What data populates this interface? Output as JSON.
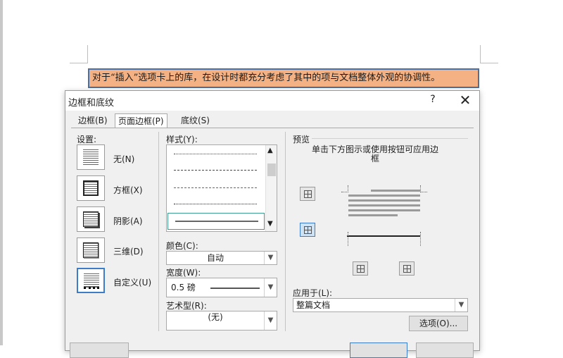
{
  "document": {
    "highlighted_text": "对于“插入”选项卡上的库，在设计时都充分考虑了其中的项与文档整体外观的协调性。"
  },
  "dialog": {
    "title": "边框和底纹",
    "help_label": "?",
    "close_label": "✕",
    "tabs": [
      {
        "label": "边框(B)"
      },
      {
        "label": "页面边框(P)"
      },
      {
        "label": "底纹(S)"
      }
    ],
    "settings": {
      "heading": "设置:",
      "items": [
        {
          "label": "无(N)"
        },
        {
          "label": "方框(X)"
        },
        {
          "label": "阴影(A)"
        },
        {
          "label": "三维(D)"
        },
        {
          "label": "自定义(U)"
        }
      ]
    },
    "style": {
      "heading": "样式(Y):",
      "color_label": "颜色(C):",
      "color_value": "自动",
      "width_label": "宽度(W):",
      "width_value": "0.5 磅",
      "art_label": "艺术型(R):",
      "art_value": "(无)"
    },
    "preview": {
      "heading": "预览",
      "description": "单击下方图示或使用按钮可应用边框",
      "apply_label": "应用于(L):",
      "apply_value": "整篇文档",
      "options_button": "选项(O)..."
    }
  }
}
